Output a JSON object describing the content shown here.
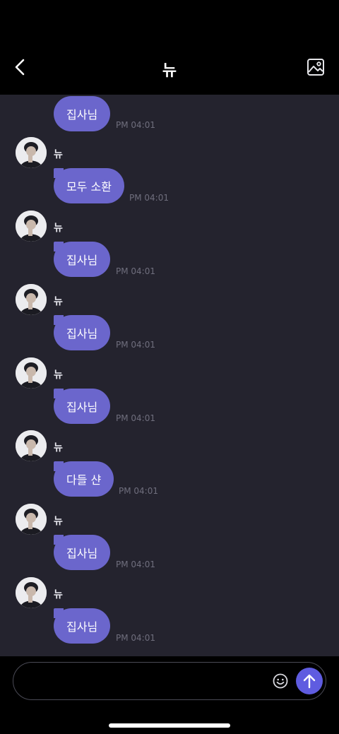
{
  "header": {
    "title": "뉴",
    "back_icon": "chevron-left-icon",
    "gallery_icon": "image-icon"
  },
  "colors": {
    "bubble": "#6b66cc",
    "chat_background": "#24232e",
    "send_button": "#5f5ce0"
  },
  "messages": [
    {
      "sender": "",
      "text": "집사님",
      "time": "PM 04:01"
    },
    {
      "sender": "뉴",
      "text": "모두 소환",
      "time": "PM 04:01"
    },
    {
      "sender": "뉴",
      "text": "집사님",
      "time": "PM 04:01"
    },
    {
      "sender": "뉴",
      "text": "집사님",
      "time": "PM 04:01"
    },
    {
      "sender": "뉴",
      "text": "집사님",
      "time": "PM 04:01"
    },
    {
      "sender": "뉴",
      "text": "다들 샨",
      "time": "PM 04:01"
    },
    {
      "sender": "뉴",
      "text": "집사님",
      "time": "PM 04:01"
    },
    {
      "sender": "뉴",
      "text": "집사님",
      "time": "PM 04:01"
    }
  ],
  "composer": {
    "value": "",
    "emoji_icon": "smiley-icon",
    "send_icon": "arrow-up-icon"
  }
}
